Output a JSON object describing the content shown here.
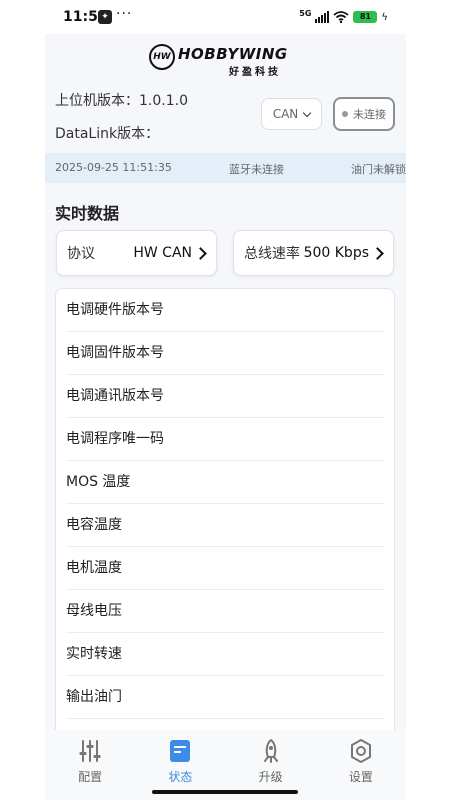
{
  "status_bar": {
    "time": "11:51",
    "wrench_glyph": "🔧",
    "more_glyph": "···",
    "network": "5G",
    "battery": "81",
    "bolt": "ϟ"
  },
  "brand": {
    "mark": "HW",
    "name": "HOBBYWING",
    "chinese": "好盈科技"
  },
  "versions": {
    "host_label": "上位机版本：",
    "host_value": "1.0.1.0",
    "datalink_label": "DataLink版本："
  },
  "connection": {
    "mode": "CAN",
    "status_label": "未连接"
  },
  "info_bar": {
    "datetime": "2025-09-25 11:51:35",
    "bluetooth": "蓝牙未连接",
    "throttle": "油门未解锁"
  },
  "realtime": {
    "title": "实时数据",
    "protocol_label": "协议",
    "protocol_value": "HW CAN",
    "bus_rate_label": "总线速率",
    "bus_rate_value": "500 Kbps"
  },
  "data_items": [
    "电调硬件版本号",
    "电调固件版本号",
    "电调通讯版本号",
    "电调程序唯一码",
    "MOS 温度",
    "电容温度",
    "电机温度",
    "母线电压",
    "实时转速",
    "输出油门"
  ],
  "tabs": [
    {
      "label": "配置",
      "icon": "sliders-icon"
    },
    {
      "label": "状态",
      "icon": "document-icon",
      "active": true
    },
    {
      "label": "升级",
      "icon": "rocket-icon"
    },
    {
      "label": "设置",
      "icon": "gear-icon"
    }
  ],
  "colors": {
    "accent": "#3d8be8",
    "info_bar_bg": "#e3eef9",
    "battery": "#2ebd4f"
  }
}
